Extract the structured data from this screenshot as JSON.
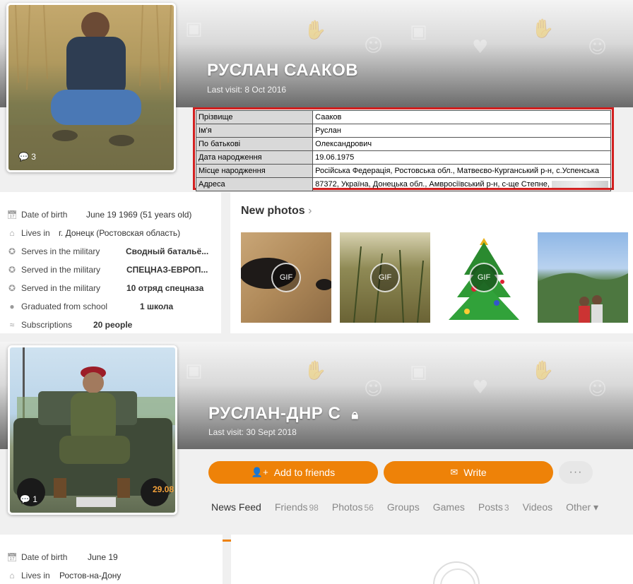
{
  "profile1": {
    "name": "РУСЛАН СААКОВ",
    "last_visit": "Last visit: 8 Oct 2016",
    "avatar_count": "3",
    "info_table": [
      {
        "key": "Прізвище",
        "value": "Сааков"
      },
      {
        "key": "Ім'я",
        "value": "Руслан"
      },
      {
        "key": "По батькові",
        "value": "Олександрович"
      },
      {
        "key": "Дата народження",
        "value": "19.06.1975"
      },
      {
        "key": "Місце народження",
        "value": "Російська Федерація, Ростовська обл., Матвеєво-Курганський р-н, с.Успенська"
      },
      {
        "key": "Адреса",
        "value": "87372, Україна, Донецька обл., Амвросіївський р-н, с-ще Степне,"
      }
    ],
    "about": [
      {
        "icon": "calendar-icon",
        "label": "Date of birth",
        "value": "June 19 1969 (51 years old)",
        "bold": false
      },
      {
        "icon": "home-icon",
        "label": "Lives in",
        "value": "г. Донецк (Ростовская область)",
        "bold": false
      },
      {
        "icon": "military-icon",
        "label": "Serves in the military",
        "value": "Сводный батальё...",
        "bold": true
      },
      {
        "icon": "military-icon",
        "label": "Served in the military",
        "value": "СПЕЦНАЗ-ЕВРОП...",
        "bold": true
      },
      {
        "icon": "military-icon",
        "label": "Served in the military",
        "value": "10 отряд спецназа",
        "bold": true
      },
      {
        "icon": "school-icon",
        "label": "Graduated from school",
        "value": "1 школа",
        "bold": true
      },
      {
        "icon": "rss-icon",
        "label": "Subscriptions",
        "value": "20 people",
        "bold": true
      }
    ],
    "new_photos_title": "New photos",
    "photos": [
      {
        "gif_label": "GIF"
      },
      {
        "gif_label": "GIF"
      },
      {
        "gif_label": "GIF"
      },
      {
        "gif_label": ""
      }
    ]
  },
  "profile2": {
    "name": "РУСЛАН-ДНР С",
    "last_visit": "Last visit: 30 Sept 2018",
    "avatar_count": "1",
    "avatar_stamp": "29.08",
    "add_friends_label": "Add to friends",
    "write_label": "Write",
    "more_label": "···",
    "tabs": [
      {
        "label": "News Feed",
        "count": "",
        "active": true
      },
      {
        "label": "Friends",
        "count": "98",
        "active": false
      },
      {
        "label": "Photos",
        "count": "56",
        "active": false
      },
      {
        "label": "Groups",
        "count": "",
        "active": false
      },
      {
        "label": "Games",
        "count": "",
        "active": false
      },
      {
        "label": "Posts",
        "count": "3",
        "active": false
      },
      {
        "label": "Videos",
        "count": "",
        "active": false
      },
      {
        "label": "Other",
        "count": "",
        "active": false
      }
    ],
    "about": [
      {
        "icon": "calendar-icon",
        "label": "Date of birth",
        "value": "June 19"
      },
      {
        "icon": "home-icon",
        "label": "Lives in",
        "value": "Ростов-на-Дону"
      }
    ]
  },
  "colors": {
    "accent": "#ee8208",
    "table_border": "#d21f1f"
  }
}
